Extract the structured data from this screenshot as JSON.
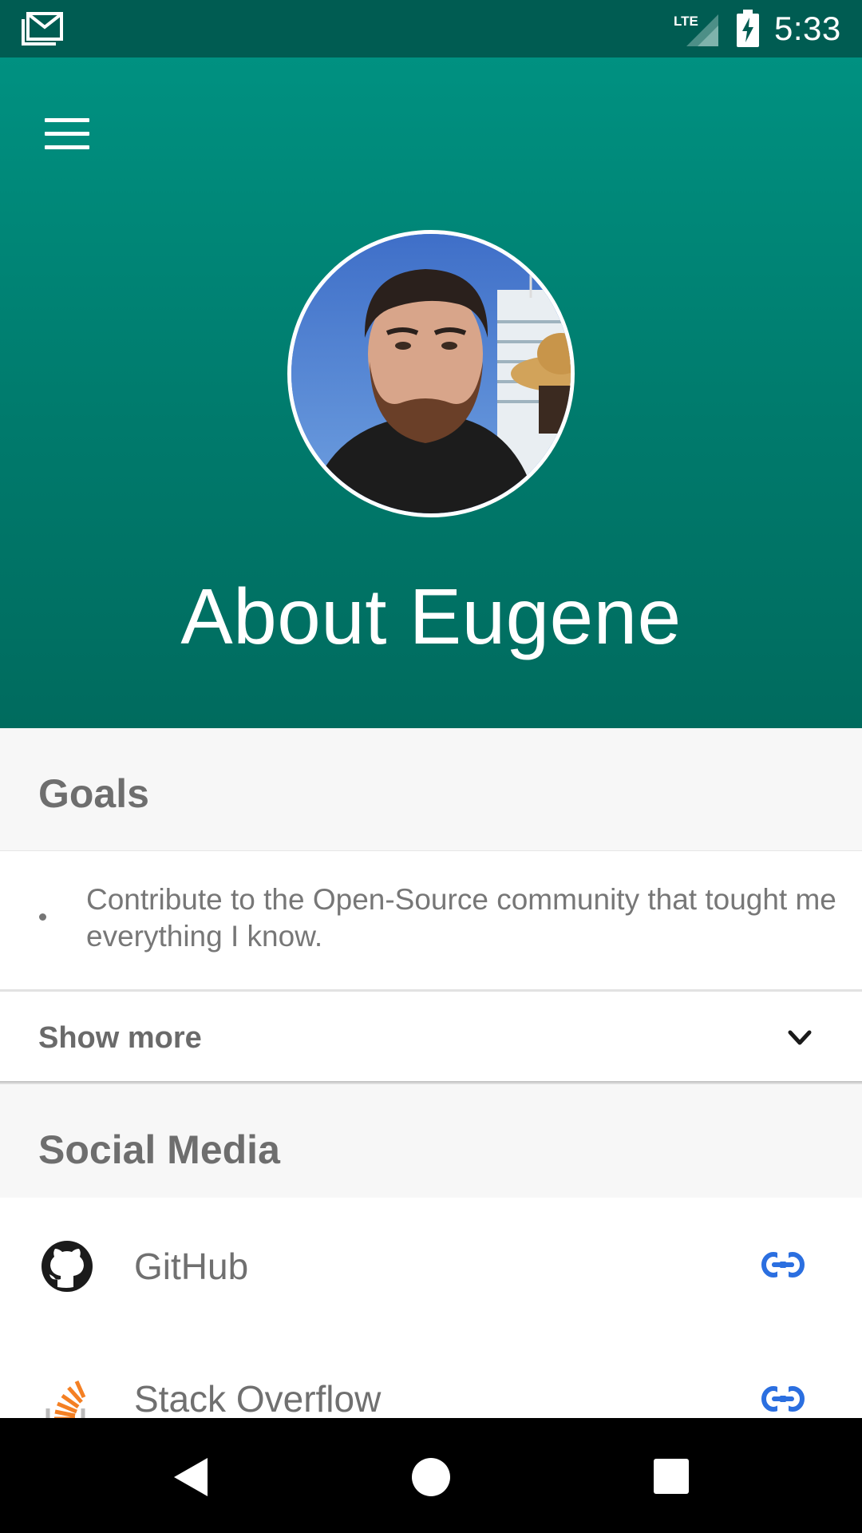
{
  "status_bar": {
    "network": "LTE",
    "time": "5:33"
  },
  "header": {
    "menu_icon": "hamburger-menu-icon",
    "title": "About Eugene",
    "avatar_alt": "Eugene profile photo"
  },
  "goals": {
    "heading": "Goals",
    "items": [
      "Contribute to the Open-Source community that tought me everything I know."
    ],
    "show_more_label": "Show more"
  },
  "social": {
    "heading": "Social Media",
    "items": [
      {
        "name": "GitHub",
        "icon": "github-icon",
        "action_icon": "link-icon"
      },
      {
        "name": "Stack Overflow",
        "icon": "stack-overflow-icon",
        "action_icon": "link-icon"
      }
    ]
  },
  "colors": {
    "header_top": "#009181",
    "header_bottom": "#006b5e",
    "status_bar": "#005c52",
    "link_blue": "#2b6fe0",
    "stack_orange": "#f48024"
  }
}
